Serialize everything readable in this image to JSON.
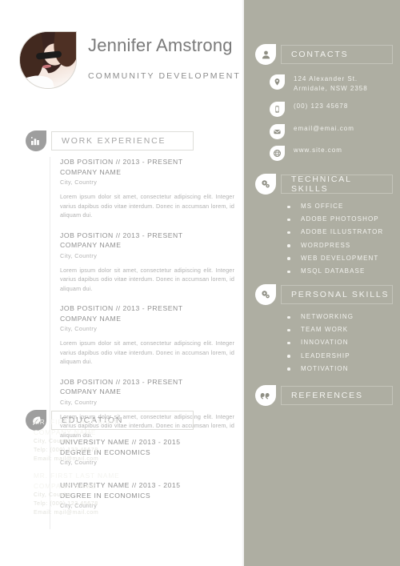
{
  "theme": {
    "sidebar_bg": "#aeaea2",
    "page_bg": "#ffffff",
    "icon_grey": "#9e9e9e",
    "text_grey": "#8f8f8f"
  },
  "header": {
    "name": "Jennifer Amstrong",
    "role": "COMMUNITY DEVELOPMENT",
    "avatar_icon": "profile-photo"
  },
  "work": {
    "heading": "WORK EXPERIENCE",
    "icon": "bar-chart-icon",
    "entries": [
      {
        "title": "JOB POSITION // 2013 - PRESENT",
        "company": "COMPANY NAME",
        "location": "City, Country",
        "description": "Lorem ipsum dolor sit amet, consectetur adipiscing elit. Integer varius dapibus odio vitae interdum. Donec in accumsan lorem, id aliquam dui."
      },
      {
        "title": "JOB POSITION // 2013 - PRESENT",
        "company": "COMPANY NAME",
        "location": "City, Country",
        "description": "Lorem ipsum dolor sit amet, consectetur adipiscing elit. Integer varius dapibus odio vitae interdum. Donec in accumsan lorem, id aliquam dui."
      },
      {
        "title": "JOB POSITION // 2013 - PRESENT",
        "company": "COMPANY NAME",
        "location": "City, Country",
        "description": "Lorem ipsum dolor sit amet, consectetur adipiscing elit. Integer varius dapibus odio vitae interdum. Donec in accumsan lorem, id aliquam dui."
      },
      {
        "title": "JOB POSITION // 2013 - PRESENT",
        "company": "COMPANY NAME",
        "location": "City, Country",
        "description": "Lorem ipsum dolor sit amet, consectetur adipiscing elit. Integer varius dapibus odio vitae interdum. Donec in accumsan lorem, id aliquam dui."
      }
    ]
  },
  "education": {
    "heading": "EDUCATION",
    "icon": "quill-pen-icon",
    "entries": [
      {
        "title": "UNIVERSITY NAME // 2013 - 2015",
        "degree": "DEGREE IN ECONOMICS",
        "location": "City, Country"
      },
      {
        "title": "UNIVERSITY NAME // 2013 - 2015",
        "degree": "DEGREE IN ECONOMICS",
        "location": "City, Country"
      }
    ],
    "trailing_mark": "."
  },
  "contacts": {
    "heading": "CONTACTS",
    "icon": "person-icon",
    "items": [
      {
        "icon": "map-pin-icon",
        "line1": "124 Alexander St.",
        "line2": "Armidale, NSW 2358"
      },
      {
        "icon": "phone-icon",
        "line1": "(00) 123 45678",
        "line2": ""
      },
      {
        "icon": "envelope-icon",
        "line1": "email@emai.com",
        "line2": ""
      },
      {
        "icon": "globe-icon",
        "line1": "www.site.com",
        "line2": ""
      }
    ]
  },
  "technical_skills": {
    "heading": "TECHNICAL SKILLS",
    "icon": "gears-icon",
    "items": [
      "MS OFFICE",
      "ADOBE PHOTOSHOP",
      "ADOBE ILLUSTRATOR",
      "WORDPRESS",
      "WEB DEVELOPMENT",
      "MSQL DATABASE"
    ]
  },
  "personal_skills": {
    "heading": "PERSONAL SKILLS",
    "icon": "gears-icon",
    "items": [
      "NETWORKING",
      "TEAM WORK",
      "INNOVATION",
      "LEADERSHIP",
      "MOTIVATION"
    ]
  },
  "references": {
    "heading": "REFERENCES",
    "icon": "quote-icon",
    "items": [
      {
        "name": "MR. FIRST LAST NAME",
        "company": "COMPANY NAME",
        "location": "City, Country",
        "phone": "Telp: (000) 123 45678",
        "email": "Email: mail@mail.com"
      },
      {
        "name": "MR. FIRST LAST NAME",
        "company": "COMPANY NAME",
        "location": "City, Country",
        "phone": "Telp: (000) 123 45678",
        "email": "Email: mail@mail.com"
      }
    ]
  }
}
